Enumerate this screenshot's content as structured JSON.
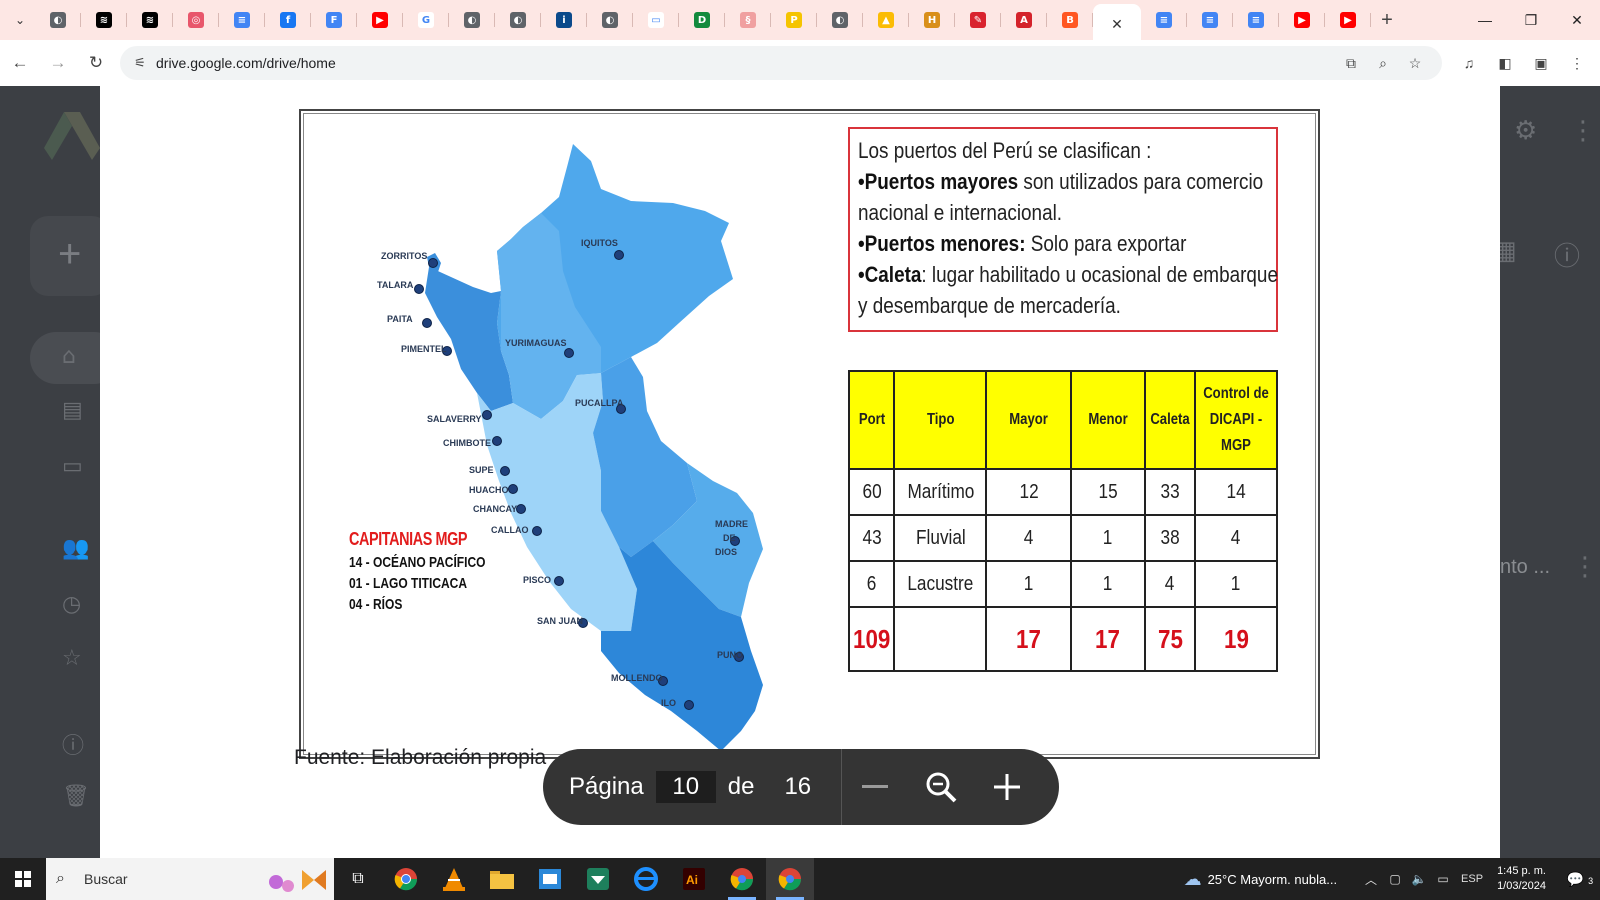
{
  "browser": {
    "tabs": [
      {
        "icon": "chrome-globe-icon",
        "color": "#5f6368",
        "glyph": "◐"
      },
      {
        "icon": "capcut-icon",
        "color": "#000000",
        "glyph": "≋"
      },
      {
        "icon": "capcut-icon",
        "color": "#000000",
        "glyph": "≋"
      },
      {
        "icon": "target-icon",
        "color": "#e8566b",
        "glyph": "◎"
      },
      {
        "icon": "google-docs-icon",
        "color": "#4285f4",
        "glyph": "≡"
      },
      {
        "icon": "facebook-icon",
        "color": "#1877f2",
        "glyph": "f"
      },
      {
        "icon": "google-forms-icon",
        "color": "#4285f4",
        "glyph": "F"
      },
      {
        "icon": "youtube-icon",
        "color": "#ff0000",
        "glyph": "▶"
      },
      {
        "icon": "google-icon",
        "color": "#ffffff",
        "glyph": "G"
      },
      {
        "icon": "chrome-globe-icon",
        "color": "#5f6368",
        "glyph": "◐"
      },
      {
        "icon": "chrome-globe-icon",
        "color": "#5f6368",
        "glyph": "◐"
      },
      {
        "icon": "site-icon",
        "color": "#0b4a8b",
        "glyph": "i"
      },
      {
        "icon": "chrome-globe-icon",
        "color": "#5f6368",
        "glyph": "◐"
      },
      {
        "icon": "site-icon",
        "color": "#ffffff",
        "glyph": "▭"
      },
      {
        "icon": "site-icon",
        "color": "#138a3d",
        "glyph": "D"
      },
      {
        "icon": "site-icon",
        "color": "#f0a0a0",
        "glyph": "§"
      },
      {
        "icon": "site-icon",
        "color": "#f5c400",
        "glyph": "P"
      },
      {
        "icon": "chrome-globe-icon",
        "color": "#5f6368",
        "glyph": "◐"
      },
      {
        "icon": "google-drive-icon",
        "color": "#fbbc04",
        "glyph": "▲"
      },
      {
        "icon": "site-icon",
        "color": "#d98f1a",
        "glyph": "H"
      },
      {
        "icon": "site-icon",
        "color": "#d9232e",
        "glyph": "✎"
      },
      {
        "icon": "acrobat-icon",
        "color": "#d4232b",
        "glyph": "A"
      },
      {
        "icon": "blogger-icon",
        "color": "#ff5722",
        "glyph": "B"
      },
      {
        "icon": "close-icon",
        "color": "#333333",
        "glyph": "✕",
        "active": true
      },
      {
        "icon": "google-docs-icon",
        "color": "#4285f4",
        "glyph": "≡"
      },
      {
        "icon": "google-docs-icon",
        "color": "#4285f4",
        "glyph": "≡"
      },
      {
        "icon": "google-docs-icon",
        "color": "#4285f4",
        "glyph": "≡"
      },
      {
        "icon": "youtube-icon",
        "color": "#ff0000",
        "glyph": "▶"
      },
      {
        "icon": "youtube-icon",
        "color": "#ff0000",
        "glyph": "▶"
      }
    ],
    "url": "drive.google.com/drive/home"
  },
  "slide": {
    "info_lines": [
      {
        "bold": "",
        "text": "Los puertos del Perú se clasifican :"
      },
      {
        "bold": "•Puertos mayores",
        "text": " son utilizados para comercio"
      },
      {
        "bold": "",
        "text": "nacional e internacional."
      },
      {
        "bold": "•Puertos menores:",
        "text": " Solo para exportar"
      },
      {
        "bold": "•Caleta",
        "text": ": lugar habilitado u ocasional de embarque"
      },
      {
        "bold": "",
        "text": "y desembarque de mercadería."
      }
    ],
    "table": {
      "headers": [
        "Port",
        "Tipo",
        "Mayor",
        "Menor",
        "Caleta",
        "Control de DICAPI - MGP"
      ],
      "rows": [
        [
          "60",
          "Marítimo",
          "12",
          "15",
          "33",
          "14"
        ],
        [
          "43",
          "Fluvial",
          "4",
          "1",
          "38",
          "4"
        ],
        [
          "6",
          "Lacustre",
          "1",
          "1",
          "4",
          "1"
        ]
      ],
      "total": [
        "109",
        "",
        "17",
        "17",
        "75",
        "19"
      ]
    },
    "capitanias": {
      "title": "CAPITANIAS MGP",
      "lines": [
        "14 -  OCÉANO PACÍFICO",
        "01 - LAGO TITICACA",
        "04 - RÍOS"
      ]
    },
    "ports": [
      {
        "name": "ZORRITOS"
      },
      {
        "name": "TALARA"
      },
      {
        "name": "PAITA"
      },
      {
        "name": "PIMENTEL"
      },
      {
        "name": "SALAVERRY"
      },
      {
        "name": "CHIMBOTE"
      },
      {
        "name": "SUPE"
      },
      {
        "name": "HUACHO"
      },
      {
        "name": "CHANCAY"
      },
      {
        "name": "CALLAO"
      },
      {
        "name": "PISCO"
      },
      {
        "name": "SAN JUAN"
      },
      {
        "name": "MOLLENDO"
      },
      {
        "name": "ILO"
      },
      {
        "name": "IQUITOS"
      },
      {
        "name": "YURIMAGUAS"
      },
      {
        "name": "PUCALLPA"
      },
      {
        "name": "MADRE DE DIOS"
      },
      {
        "name": "PUNO"
      }
    ],
    "caption": "Fuente: Elaboración propia"
  },
  "viewer": {
    "page_label": "Página",
    "current_page": "10",
    "of_label": "de",
    "total_pages": "16"
  },
  "drive_partial": {
    "right_text": "nto ..."
  },
  "taskbar": {
    "search_label": "Buscar",
    "weather": "25°C  Mayorm. nubla...",
    "language": "ESP",
    "time": "1:45 p. m.",
    "date": "1/03/2024",
    "notifications": "3"
  }
}
